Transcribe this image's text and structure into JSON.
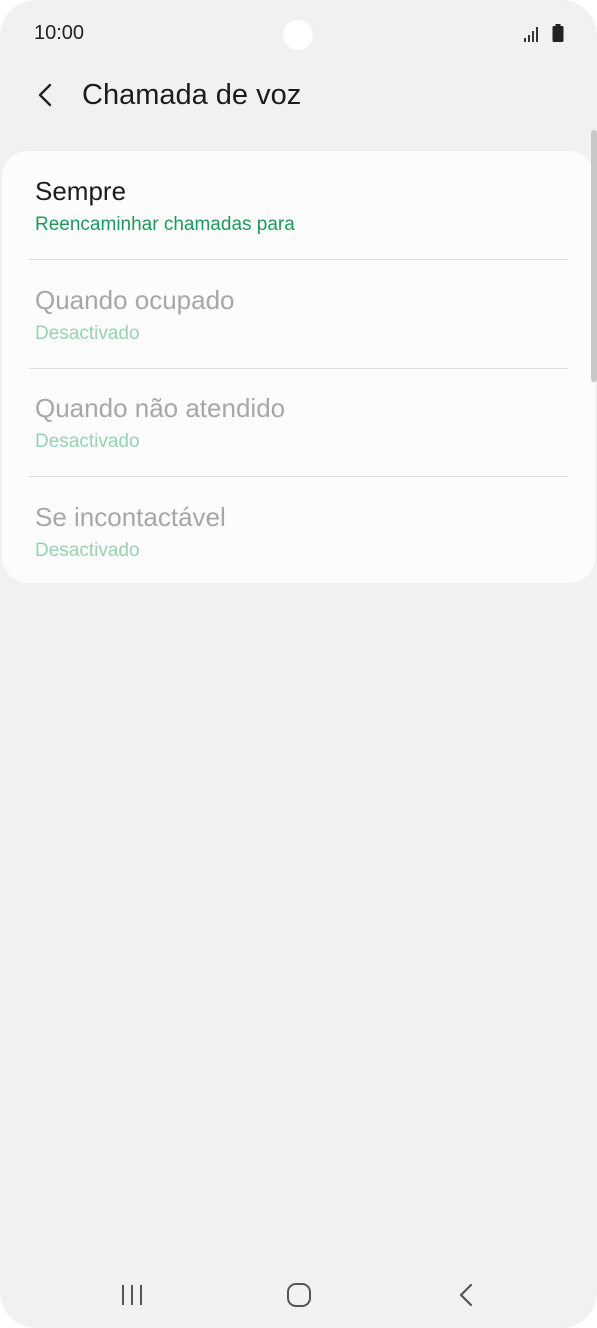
{
  "status_bar": {
    "time": "10:00"
  },
  "app_bar": {
    "title": "Chamada de voz",
    "back_icon": "chevron-left-icon"
  },
  "forwarding_options": [
    {
      "title": "Sempre",
      "subtitle": "Reencaminhar chamadas para",
      "enabled": true
    },
    {
      "title": "Quando ocupado",
      "subtitle": "Desactivado",
      "enabled": false
    },
    {
      "title": "Quando não atendido",
      "subtitle": "Desactivado",
      "enabled": false
    },
    {
      "title": "Se incontactável",
      "subtitle": "Desactivado",
      "enabled": false
    }
  ],
  "nav_bar": {
    "recents_icon": "recents-icon",
    "home_icon": "home-icon",
    "back_icon": "back-icon"
  },
  "colors": {
    "background": "#f1f1f1",
    "card": "#fcfcfc",
    "accent_green": "#1c9a5b",
    "disabled_green": "#97d2b3"
  }
}
